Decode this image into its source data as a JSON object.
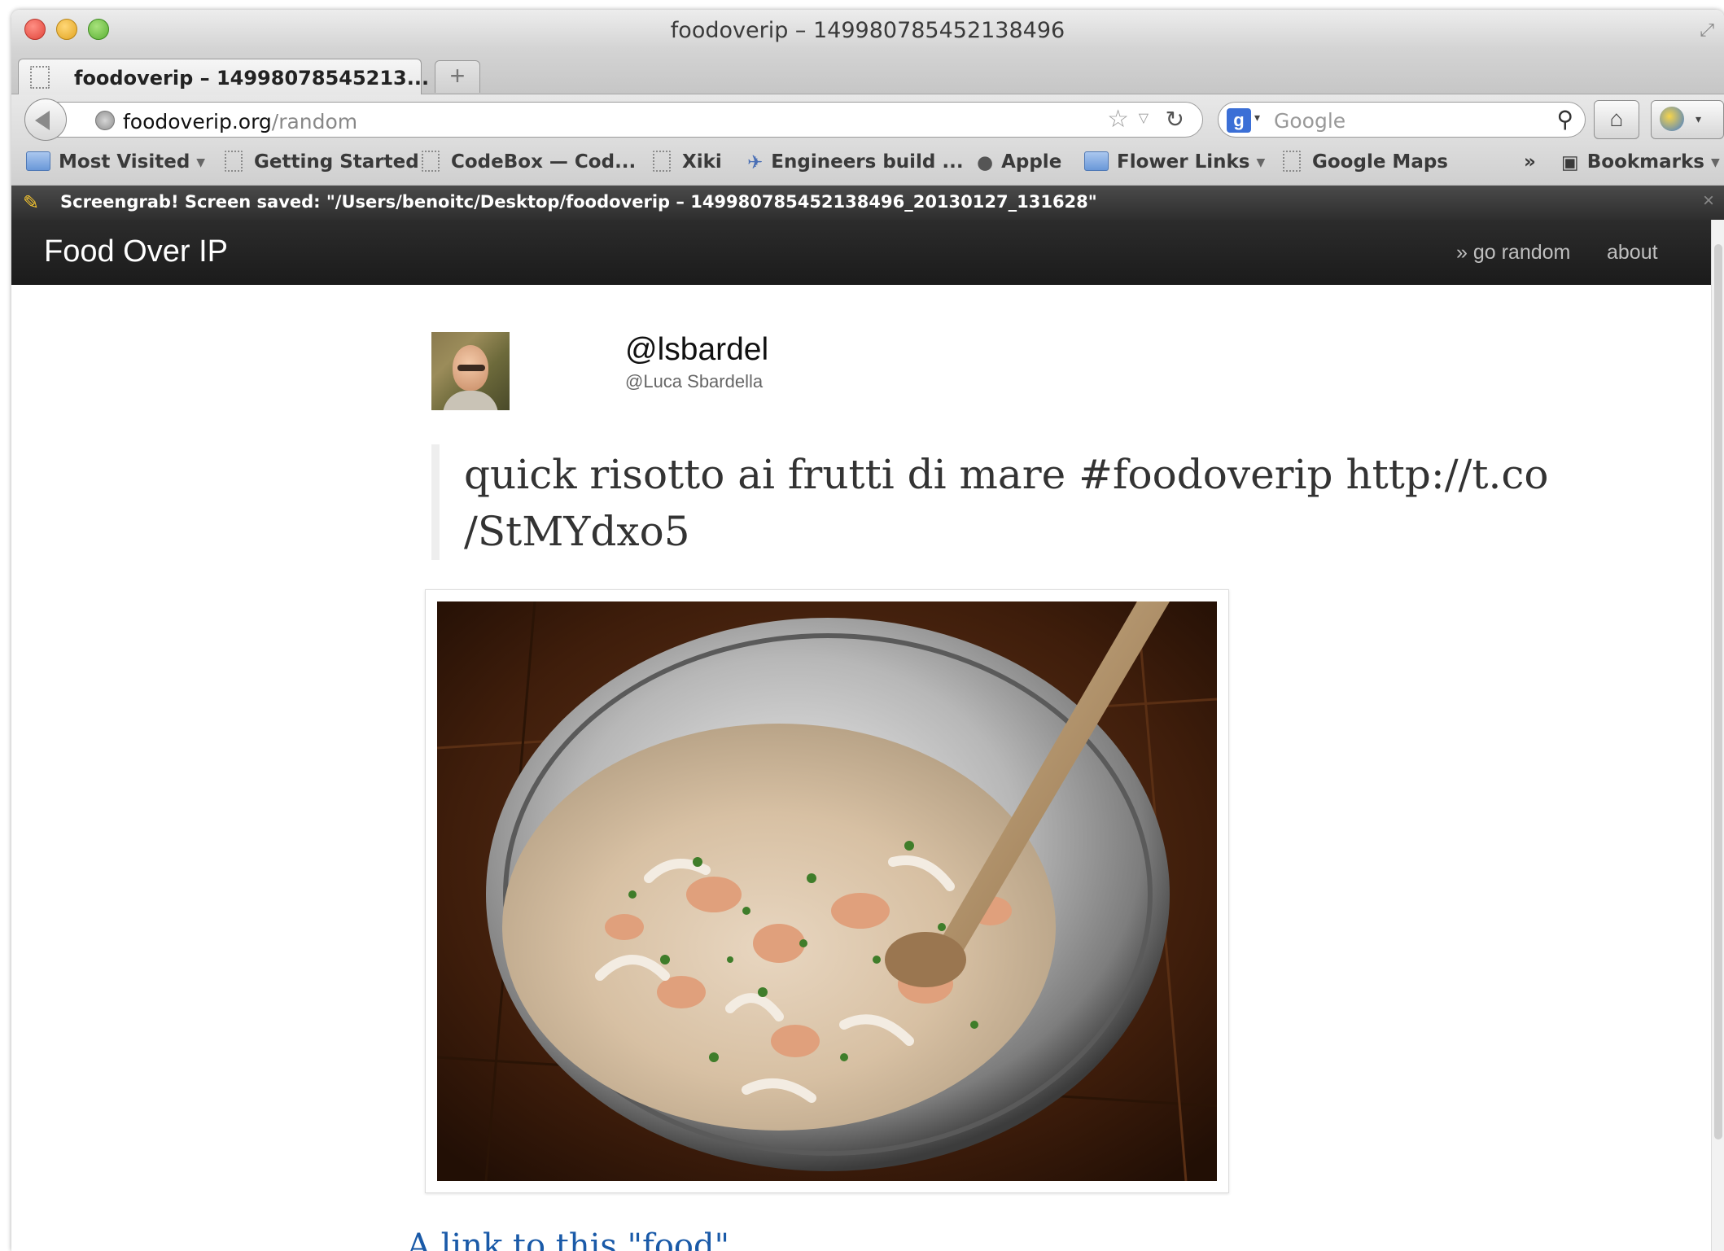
{
  "window": {
    "title": "foodoverip – 149980785452138496"
  },
  "tabs": [
    {
      "label": "foodoverip – 14998078545213..."
    }
  ],
  "newtab": {
    "label": "+"
  },
  "urlbar": {
    "host": "foodoverip.org",
    "path": "/random"
  },
  "search": {
    "engine_letter": "g",
    "placeholder": "Google"
  },
  "bookmarks": [
    {
      "label": "Most Visited",
      "icon": "smart-folder-icon",
      "menu": true
    },
    {
      "label": "Getting Started",
      "icon": "page-icon"
    },
    {
      "label": "CodeBox — Cod...",
      "icon": "page-icon"
    },
    {
      "label": "Xiki",
      "icon": "page-icon"
    },
    {
      "label": "Engineers build ...",
      "icon": "robot-icon"
    },
    {
      "label": "Apple",
      "icon": "apple-icon"
    },
    {
      "label": "Flower Links",
      "icon": "folder-icon",
      "menu": true
    },
    {
      "label": "Google Maps",
      "icon": "page-icon"
    }
  ],
  "bookmarks_overflow": "»",
  "bookmarks_menu": {
    "label": "Bookmarks"
  },
  "notification": {
    "text": "Screengrab! Screen saved: \"/Users/benoitc/Desktop/foodoverip – 149980785452138496_20130127_131628\"",
    "close": "×"
  },
  "site": {
    "brand": "Food Over IP",
    "nav": {
      "random": "» go random",
      "about": "about"
    }
  },
  "tweet": {
    "handle": "@lsbardel",
    "fullname": "@Luca Sbardella",
    "text": "quick risotto ai frutti di mare #foodoverip http://t.co /StMYdxo5",
    "photo_alt": "risotto ai frutti di mare in a steel pan with a wooden spoon",
    "link_text": "A link to this \"food\""
  },
  "colors": {
    "site_nav_bg": "#1f1f1f",
    "link": "#1a5aa8",
    "notification_bg": "#3a3a3a"
  }
}
